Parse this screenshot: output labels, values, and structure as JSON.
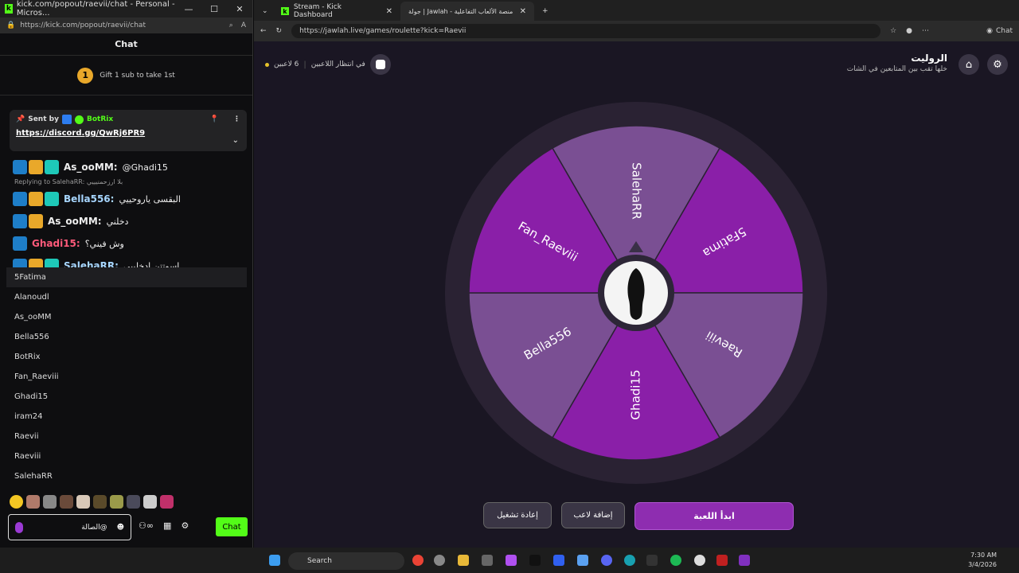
{
  "left_window": {
    "title": "kick.com/popout/raevii/chat - Personal - Micros...",
    "url": "https://kick.com/popout/raevii/chat",
    "chat_header": "Chat",
    "gift_rank": "1",
    "gift_text": "Gift 1 sub to take 1st",
    "pinned": {
      "sent_by_label": "Sent by",
      "sender": "BotRix",
      "link": "https://discord.gg/QwRj6PR9"
    },
    "messages": [
      {
        "user": "As_ooMM:",
        "text": "@Ghadi15",
        "color": "#ffffff"
      },
      {
        "reply": "Replying to SalehaRR: بلا ارزحمنيييي"
      },
      {
        "user": "Bella556:",
        "text": "البقسى ياروحييي",
        "color": "#a7d6ff"
      },
      {
        "user": "As_ooMM:",
        "text": "دخلني",
        "color": "#ffffff"
      },
      {
        "user": "Ghadi15:",
        "text": "وش فيني؟",
        "color": "#ff5a7a"
      },
      {
        "user": "SalehaRR:",
        "text": "اسوتتن ادخلييي",
        "color": "#a7d6ff"
      }
    ],
    "player_list": [
      "5Fatima",
      "Alanoudl",
      "As_ooMM",
      "Bella556",
      "BotRix",
      "Fan_Raeviii",
      "Ghadi15",
      "iram24",
      "Raevii",
      "Raeviii",
      "SalehaRR"
    ],
    "input_value": "@الصالة",
    "chat_button": "Chat"
  },
  "right_window": {
    "tabs": [
      {
        "label": "Stream - Kick Dashboard"
      },
      {
        "label": "جولة | Jawlah - منصة الألعاب التفاعلية"
      }
    ],
    "url": "https://jawlah.live/games/roulette?kick=Raevii",
    "chat_label": "Chat",
    "game_title": "الروليت",
    "game_subtitle": "خلها تقب بين المتابعين في الشات",
    "players_count": "6 لاعبين",
    "waiting_text": "في انتظار اللاعبين",
    "wheel_segments": [
      {
        "name": "SalehaRR",
        "color": "#7a4f93"
      },
      {
        "name": "5Fatima",
        "color": "#8a1fa8"
      },
      {
        "name": "Raeviii",
        "color": "#7a4f93"
      },
      {
        "name": "Ghadi15",
        "color": "#8a1fa8"
      },
      {
        "name": "Bella556",
        "color": "#7a4f93"
      },
      {
        "name": "Fan_Raeviii",
        "color": "#8a1fa8"
      }
    ],
    "buttons": {
      "reset": "إعادة تشغيل",
      "add_player": "إضافة لاعب",
      "start": "ابدأ اللعبة"
    }
  },
  "taskbar": {
    "search": "Search",
    "time": "7:30 AM",
    "date": "3/4/2026"
  }
}
